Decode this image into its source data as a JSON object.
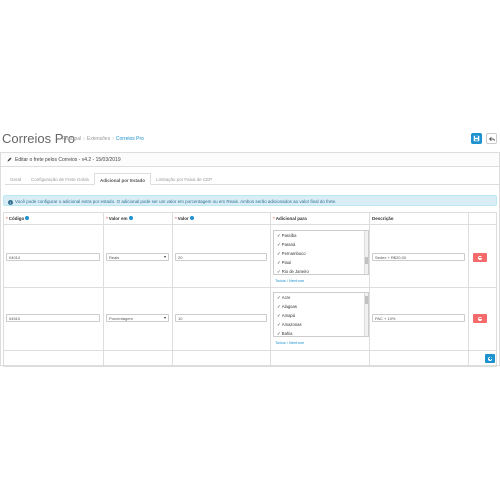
{
  "header": {
    "title": "Correios Pro",
    "breadcrumb": [
      "Principal",
      "Extensões",
      "Correios Pro"
    ]
  },
  "panel": {
    "heading": "Editar o frete pelos Correios - v4.2 - 15/03/2019"
  },
  "tabs": [
    {
      "label": "Geral",
      "active": false
    },
    {
      "label": "Configuração de Frete Grátis",
      "active": false
    },
    {
      "label": "Adicional por Estado",
      "active": true
    },
    {
      "label": "Limitação por Faixa de CEP",
      "active": false
    }
  ],
  "alert": {
    "text": "Você pode configurar o adicional extra por estado. O adicional pode ser um valor em porcentagem ou em Reais. Ambos serão adicionados ao valor final do frete."
  },
  "table": {
    "headers": {
      "codigo": "Código",
      "valor_em": "Valor em",
      "valor": "Valor",
      "adicional_para": "Adicional para",
      "descricao": "Descrição"
    },
    "rows": [
      {
        "codigo": "04014",
        "valor_em": "Reais",
        "valor": "20",
        "estados": [
          "Paraíba",
          "Paraná",
          "Pernambuco",
          "Piauí",
          "Rio de Janeiro"
        ],
        "toggle_link": "Todos / Nenhum",
        "descricao": "Sedex + R$20,00"
      },
      {
        "codigo": "04510",
        "valor_em": "Porcentagem",
        "valor": "10",
        "estados": [
          "Acre",
          "Alagoas",
          "Amapá",
          "Amazonas",
          "Bahia"
        ],
        "toggle_link": "Todos / Nenhum",
        "descricao": "PAC + 10%"
      }
    ]
  },
  "colors": {
    "primary": "#1e91cf",
    "danger": "#f56b6b",
    "info_bg": "#d9edf7",
    "info_text": "#31708f"
  }
}
